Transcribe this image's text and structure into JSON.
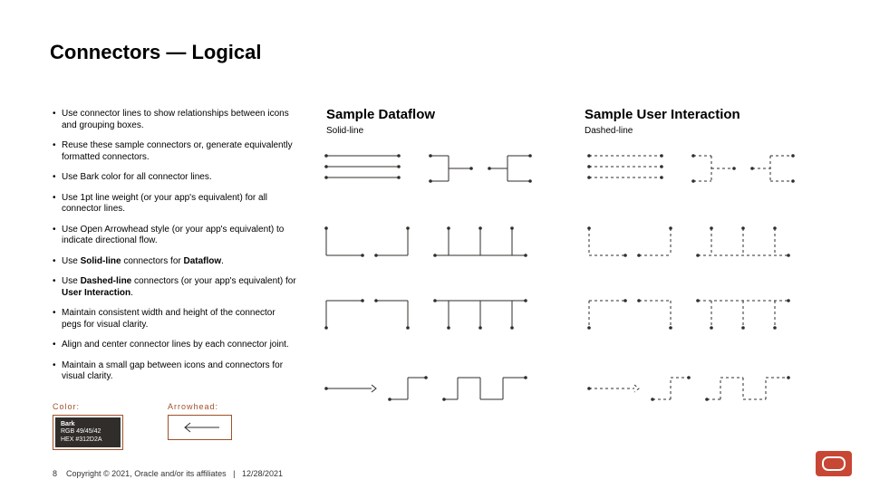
{
  "title": "Connectors — Logical",
  "bullets": [
    "Use connector lines to show relationships between icons and grouping boxes.",
    "Reuse these sample connectors or, generate equivalently formatted connectors.",
    "Use Bark color for all connector lines.",
    "Use 1pt line weight (or your app's equivalent) for all connector lines.",
    "Use Open Arrowhead style (or your app's equivalent) to indicate directional flow.",
    "Use Solid-line connectors for Dataflow.",
    "Use Dashed-line connectors (or your app's equivalent) for User Interaction.",
    "Maintain consistent width and height of the connector pegs for visual clarity.",
    "Align and center connector lines by each connector joint.",
    "Maintain a small gap between icons and connectors for visual clarity."
  ],
  "section_labels": {
    "color": "Color:",
    "arrowhead": "Arrowhead:"
  },
  "swatch": {
    "name": "Bark",
    "rgb": "RGB 49/45/42",
    "hex": "HEX #312D2A"
  },
  "columns": {
    "dataflow": {
      "title": "Sample Dataflow",
      "sub": "Solid-line"
    },
    "user": {
      "title": "Sample User Interaction",
      "sub": "Dashed-line"
    }
  },
  "connector_color": "#312D2A",
  "footer": {
    "page": "8",
    "copyright": "Copyright © 2021, Oracle and/or its affiliates",
    "sep": "|",
    "date": "12/28/2021"
  }
}
